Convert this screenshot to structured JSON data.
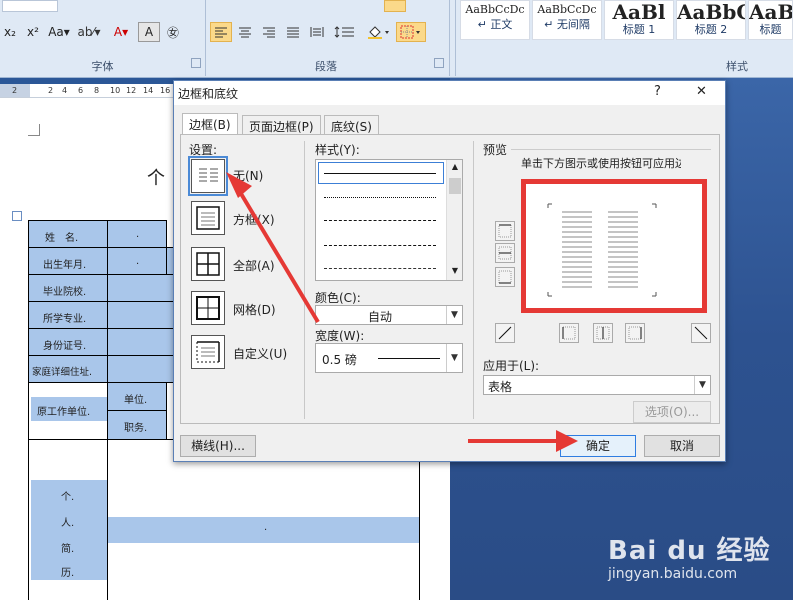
{
  "ribbon": {
    "font_group_label": "字体",
    "paragraph_group_label": "段落",
    "styles_group_label": "样式",
    "font_buttons": [
      "x₂",
      "x²",
      "Aa▾",
      "ab⁄▾",
      "A▾",
      "A",
      "㊛"
    ],
    "styles": [
      {
        "preview": "AaBbCcDc",
        "name": "↵ 正文",
        "big": false
      },
      {
        "preview": "AaBbCcDc",
        "name": "↵ 无间隔",
        "big": false
      },
      {
        "preview": "AaBl",
        "name": "标题 1",
        "big": true
      },
      {
        "preview": "AaBbC",
        "name": "标题 2",
        "big": true
      },
      {
        "preview": "AaBb",
        "name": "标题",
        "big": true
      }
    ]
  },
  "ruler": {
    "ticks": [
      "2",
      "",
      "2",
      "4",
      "6",
      "8",
      "10",
      "12",
      "14",
      "16"
    ]
  },
  "document": {
    "heading_char": "个",
    "rows": [
      {
        "label": "姓　名.",
        "mid": "."
      },
      {
        "label": "出生年月.",
        "mid": "."
      },
      {
        "label": "毕业院校.",
        "mid": ""
      },
      {
        "label": "所学专业.",
        "mid": ""
      },
      {
        "label": "身份证号.",
        "mid": ""
      },
      {
        "label": "家庭详细住址.",
        "mid": ""
      }
    ],
    "prev_unit_label": "原工作单位.",
    "unit_label": "单位.",
    "duty_label": "职务.",
    "resume_chars": [
      "个.",
      "人.",
      "简.",
      "历."
    ],
    "resume_dot": "."
  },
  "dialog": {
    "title": "边框和底纹",
    "help": "?",
    "close": "✕",
    "tabs": [
      "边框(B)",
      "页面边框(P)",
      "底纹(S)"
    ],
    "settings_label": "设置:",
    "settings": [
      "无(N)",
      "方框(X)",
      "全部(A)",
      "网格(D)",
      "自定义(U)"
    ],
    "style_label": "样式(Y):",
    "color_label": "颜色(C):",
    "color_value": "自动",
    "width_label": "宽度(W):",
    "width_value": "0.5 磅",
    "preview_label": "预览",
    "preview_hint": "单击下方图示或使用按钮可应用边框",
    "apply_label": "应用于(L):",
    "apply_value": "表格",
    "options_button": "选项(O)...",
    "hline_button": "横线(H)...",
    "ok_button": "确定",
    "cancel_button": "取消"
  },
  "watermark": {
    "logo": "Bai du 经验",
    "url": "jingyan.baidu.com"
  },
  "colors": {
    "highlight": "#e53935",
    "arrow": "#e53935",
    "table_blue": "#a9c6ea"
  }
}
